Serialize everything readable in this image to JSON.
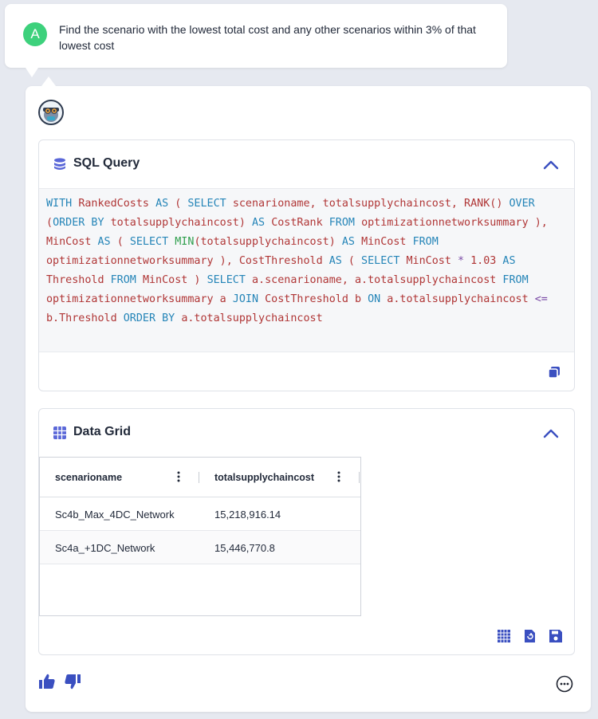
{
  "user_message": {
    "avatar_letter": "A",
    "text": "Find the scenario with the lowest total cost and any other scenarios within 3% of that lowest cost"
  },
  "sql_panel": {
    "title": "SQL Query",
    "query_tokens": [
      [
        "kw",
        "WITH "
      ],
      [
        "id",
        "RankedCosts "
      ],
      [
        "kw",
        "AS "
      ],
      [
        "id",
        "( "
      ],
      [
        "kw",
        "SELECT "
      ],
      [
        "id",
        "scenarioname, totalsupplychaincost, RANK() "
      ],
      [
        "kw",
        "OVER "
      ],
      [
        "id",
        "("
      ],
      [
        "kw",
        "ORDER BY "
      ],
      [
        "id",
        "totalsupplychaincost) "
      ],
      [
        "kw",
        "AS "
      ],
      [
        "id",
        "CostRank "
      ],
      [
        "kw",
        "FROM "
      ],
      [
        "id",
        "optimizationnetworksummary ), MinCost "
      ],
      [
        "kw",
        "AS "
      ],
      [
        "id",
        "( "
      ],
      [
        "kw",
        "SELECT "
      ],
      [
        "fn",
        "MIN"
      ],
      [
        "id",
        "(totalsupplychaincost) "
      ],
      [
        "kw",
        "AS "
      ],
      [
        "id",
        "MinCost "
      ],
      [
        "kw",
        "FROM "
      ],
      [
        "id",
        "optimizationnetworksummary ), "
      ],
      [
        "id",
        "CostThreshold "
      ],
      [
        "kw",
        "AS "
      ],
      [
        "id",
        "( "
      ],
      [
        "kw",
        "SELECT "
      ],
      [
        "id",
        "MinCost "
      ],
      [
        "op",
        "* "
      ],
      [
        "id",
        "1.03 "
      ],
      [
        "kw",
        "AS "
      ],
      [
        "id",
        "Threshold "
      ],
      [
        "kw",
        "FROM "
      ],
      [
        "id",
        "MinCost ) "
      ],
      [
        "kw",
        "SELECT "
      ],
      [
        "id",
        "a.scenarioname, a.totalsupplychaincost "
      ],
      [
        "kw",
        "FROM "
      ],
      [
        "id",
        "optimizationnetworksummary a "
      ],
      [
        "kw",
        "JOIN "
      ],
      [
        "id",
        "CostThreshold b "
      ],
      [
        "kw",
        "ON "
      ],
      [
        "id",
        "a.totalsupplychaincost "
      ],
      [
        "op",
        "<= "
      ],
      [
        "id",
        "b.Threshold "
      ],
      [
        "kw",
        "ORDER BY "
      ],
      [
        "id",
        "a.totalsupplychaincost"
      ]
    ]
  },
  "grid_panel": {
    "title": "Data Grid",
    "columns": [
      "scenarioname",
      "totalsupplychaincost"
    ],
    "rows": [
      [
        "Sc4b_Max_4DC_Network",
        "15,218,916.14"
      ],
      [
        "Sc4a_+1DC_Network",
        "15,446,770.8"
      ]
    ]
  },
  "icons": {
    "sql": "database-icon",
    "grid": "grid-icon",
    "copy": "copy-icon",
    "collapse": "chevron-up-icon",
    "thumbs_up": "thumbs-up-icon",
    "thumbs_down": "thumbs-down-icon",
    "more": "more-options-icon"
  },
  "colors": {
    "accent": "#3a4fc0",
    "user_avatar": "#3dd17c",
    "keyword": "#2585b8",
    "identifier": "#b03636",
    "function": "#2e9e4c"
  }
}
